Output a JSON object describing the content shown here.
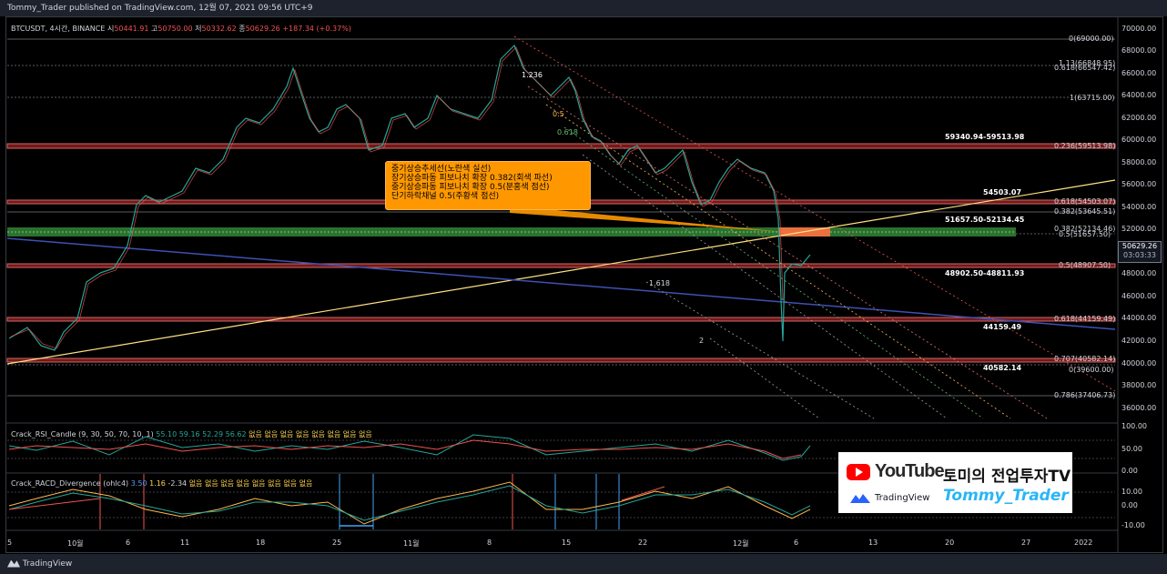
{
  "header": {
    "publisher_line": "Tommy_Trader published on TradingView.com, 12월 07, 2021 09:56 UTC+9"
  },
  "symbol_line": {
    "symbol": "BTCUSDT, 4시간, BINANCE",
    "open_label": "시",
    "open": "50441.91",
    "high_label": "고",
    "high": "50750.00",
    "low_label": "저",
    "low": "50332.62",
    "close_label": "종",
    "close": "50629.26",
    "change": "+187.34 (+0.37%)"
  },
  "price_axis": {
    "ticks": [
      "70000.00",
      "68000.00",
      "66000.00",
      "64000.00",
      "62000.00",
      "60000.00",
      "58000.00",
      "56000.00",
      "54000.00",
      "52000.00",
      "48000.00",
      "46000.00",
      "44000.00",
      "42000.00",
      "40000.00",
      "38000.00",
      "36000.00"
    ],
    "current_price": "50629.26",
    "countdown": "03:03:33"
  },
  "time_axis": {
    "ticks": [
      "5",
      "10월",
      "6",
      "11",
      "18",
      "25",
      "11월",
      "8",
      "15",
      "22",
      "12월",
      "6",
      "13",
      "20",
      "27",
      "2022"
    ]
  },
  "fib_labels": [
    "0(69000.00)",
    "1.13(66848.95)",
    "0.618(66547.42)",
    "1(63715.00)",
    "0.236(59513.98)",
    "0.618(54503.07)",
    "0.382(53645.51)",
    "0.382(52134.46)",
    "0.5(51657.50)",
    "0.5(48907.50)",
    "0.618(44159.49)",
    "0.707(40582.14)",
    "0(39600.00)",
    "0.786(37406.73)"
  ],
  "zone_labels": [
    "59340.94-59513.98",
    "54503.07",
    "51657.50-52134.45",
    "48902.50-48811.93",
    "44159.49",
    "40582.14"
  ],
  "channel_labels": [
    "1.236",
    "0.5",
    "0.618",
    "1.618",
    "2"
  ],
  "callout": {
    "lines": [
      "중기상승추세선(노란색 실선)",
      "장기상승파동 피보나치 확장 0.382(회색 파선)",
      "중기상승파동 피보나치 확장 0.5(분홍색 점선)",
      "단기하락채널 0.5(주황색 점선)"
    ]
  },
  "rsi_panel": {
    "name": "Crack_RSI_Candle",
    "params": "(9, 30, 50, 70, 10, 1)",
    "values": [
      "55.10",
      "59.16",
      "52.29",
      "56.62"
    ],
    "na_values": [
      "없음",
      "없음",
      "없음",
      "없음",
      "없음",
      "없음",
      "없음",
      "없음"
    ],
    "ticks": [
      "100.00",
      "50.00",
      "0.00"
    ]
  },
  "macd_panel": {
    "name": "Crack_RACD_Divergence",
    "params": "(ohlc4)",
    "values": [
      "3.50",
      "1.16",
      "-2.34"
    ],
    "na_values": [
      "없음",
      "없음",
      "없음",
      "없음",
      "없음",
      "없음",
      "없음",
      "없음"
    ],
    "ticks": [
      "10.00",
      "0.00",
      "-10.00"
    ]
  },
  "brand": {
    "youtube": "YouTube",
    "tradingview": "TradingView",
    "channel_title": "토미의 전업투자TV",
    "author": "Tommy_Trader"
  },
  "footer": {
    "logo_text": "TradingView"
  },
  "colors": {
    "up": "#26a69a",
    "down": "#ef5350",
    "trend_yellow": "#ffe082",
    "trend_blue": "#3f51b5",
    "zone_red": "#e57373",
    "zone_green": "#43a047",
    "callout": "#ff9800"
  }
}
